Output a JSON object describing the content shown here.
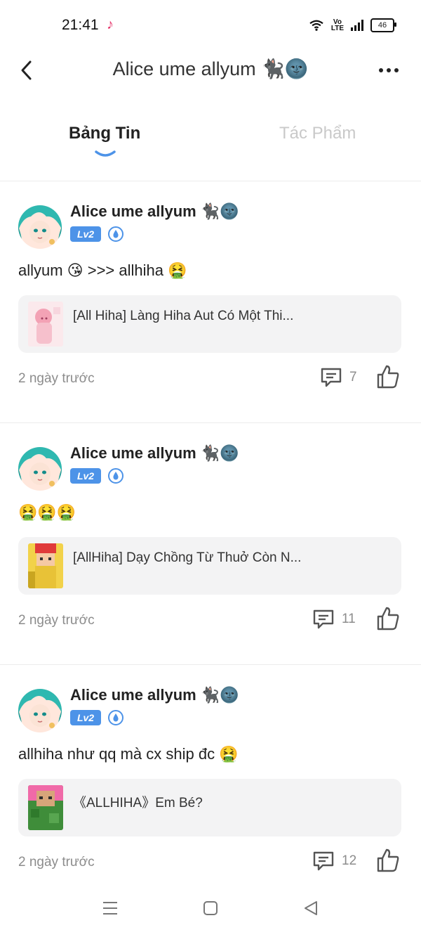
{
  "status_bar": {
    "time": "21:41"
  },
  "header": {
    "title": "Alice ume allyum 🐈‍⬛🌚"
  },
  "tabs": [
    {
      "label": "Bảng Tin",
      "active": true
    },
    {
      "label": "Tác Phẩm",
      "active": false
    }
  ],
  "posts": [
    {
      "author": "Alice ume allyum 🐈‍⬛🌚",
      "level": "Lv2",
      "text": "allyum 😘 >>> allhiha 🤮",
      "card_title": "[All Hiha] Làng Hiha Aut Có Một Thi...",
      "time": "2 ngày trước",
      "comments": "7"
    },
    {
      "author": "Alice ume allyum 🐈‍⬛🌚",
      "level": "Lv2",
      "text": "🤮🤮🤮",
      "card_title": "[AllHiha] Dạy Chồng Từ Thuở Còn N...",
      "time": "2 ngày trước",
      "comments": "11"
    },
    {
      "author": "Alice ume allyum 🐈‍⬛🌚",
      "level": "Lv2",
      "text": "allhiha như qq mà cx ship đc 🤮",
      "card_title": "《ALLHIHA》Em Bé?",
      "time": "2 ngày trước",
      "comments": "12"
    }
  ],
  "colors": {
    "accent": "#4d93e8",
    "muted": "#8c8c8c",
    "card_bg": "#f3f3f4"
  },
  "icons": {
    "back": "chevron-left-icon",
    "more": "more-dots-icon",
    "comment": "comment-icon",
    "like": "thumbs-up-icon",
    "badge": "water-drop-icon"
  }
}
